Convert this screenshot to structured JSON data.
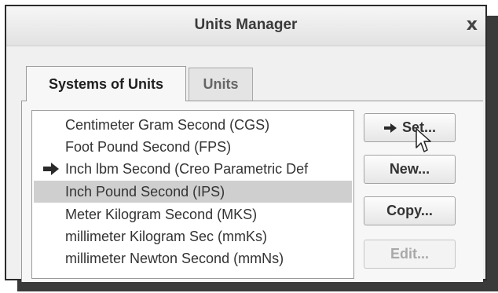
{
  "window": {
    "title": "Units Manager",
    "close_glyph": "x"
  },
  "tabs": [
    {
      "label": "Systems of Units",
      "active": true
    },
    {
      "label": "Units",
      "active": false
    }
  ],
  "systems_list": {
    "items": [
      {
        "label": "Centimeter Gram Second (CGS)",
        "current": false,
        "selected": false
      },
      {
        "label": "Foot Pound Second (FPS)",
        "current": false,
        "selected": false
      },
      {
        "label": "Inch lbm Second (Creo Parametric Def",
        "current": true,
        "selected": false
      },
      {
        "label": "Inch Pound Second (IPS)",
        "current": false,
        "selected": true
      },
      {
        "label": "Meter Kilogram Second (MKS)",
        "current": false,
        "selected": false
      },
      {
        "label": "millimeter Kilogram Sec (mmKs)",
        "current": false,
        "selected": false
      },
      {
        "label": "millimeter Newton Second (mmNs)",
        "current": false,
        "selected": false
      }
    ],
    "current_marker_icon": "right-arrow-icon"
  },
  "buttons": {
    "set": {
      "label": "Set...",
      "icon": "right-arrow-icon"
    },
    "new": {
      "label": "New..."
    },
    "copy": {
      "label": "Copy..."
    },
    "edit": {
      "label": "Edit...",
      "disabled": true
    }
  },
  "colors": {
    "selected_row": "#cfcfcf",
    "title_text": "#3a3a3a",
    "disabled_text": "#a9a9a9"
  }
}
